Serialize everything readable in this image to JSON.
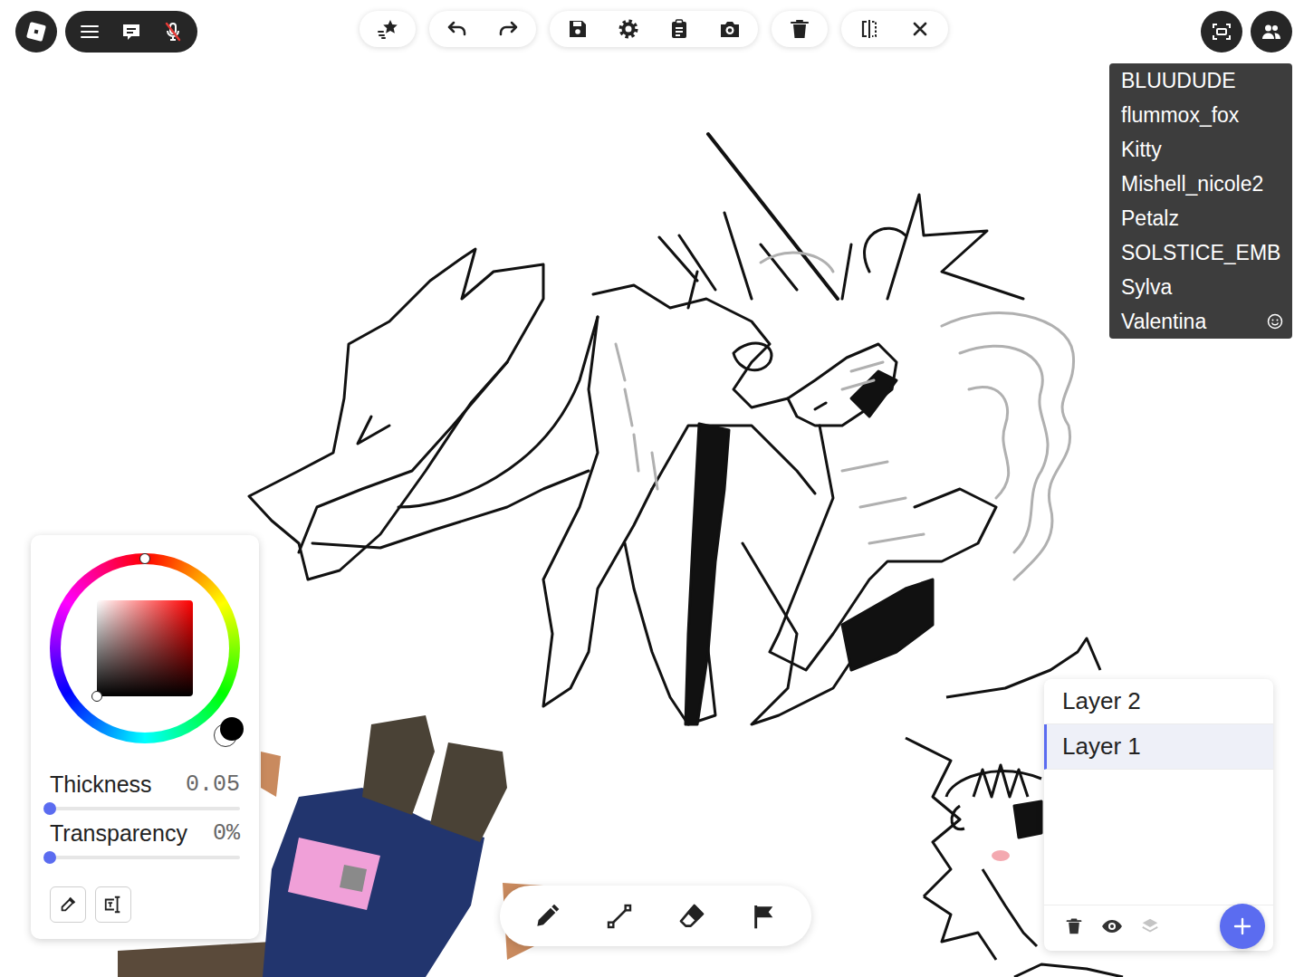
{
  "roblox_menu": {
    "mic_muted": true
  },
  "players": [
    {
      "name": "BLUUDUDE",
      "status_icon": false
    },
    {
      "name": "flummox_fox",
      "status_icon": false
    },
    {
      "name": "Kitty",
      "status_icon": false
    },
    {
      "name": "Mishell_nicole2",
      "status_icon": false
    },
    {
      "name": "Petalz",
      "status_icon": false
    },
    {
      "name": "SOLSTICE_EMB",
      "status_icon": false
    },
    {
      "name": "Sylva",
      "status_icon": false
    },
    {
      "name": "Valentina",
      "status_icon": true
    }
  ],
  "color_picker": {
    "hue": 0,
    "saturation": 0,
    "brightness": 0,
    "current_color": "#000000"
  },
  "sliders": [
    {
      "label": "Thickness",
      "reading": "0.05",
      "level": 0
    },
    {
      "label": "Transparency",
      "reading": "0%",
      "level": 0
    }
  ],
  "layers": [
    {
      "label": "Layer 2",
      "selected": false
    },
    {
      "label": "Layer 1",
      "selected": true
    }
  ]
}
